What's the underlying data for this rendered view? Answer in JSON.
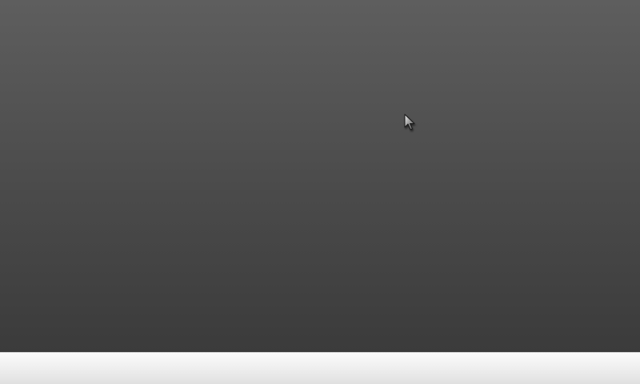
{
  "screen": {
    "desktop_background": {
      "gradient_top": "#5e5e5e",
      "gradient_bottom": "#3b3b3b"
    },
    "taskbar": {
      "gradient_top": "#fbfbfb",
      "gradient_bottom": "#e0e0e0"
    },
    "cursor": {
      "icon": "arrow-pointer-icon"
    }
  }
}
